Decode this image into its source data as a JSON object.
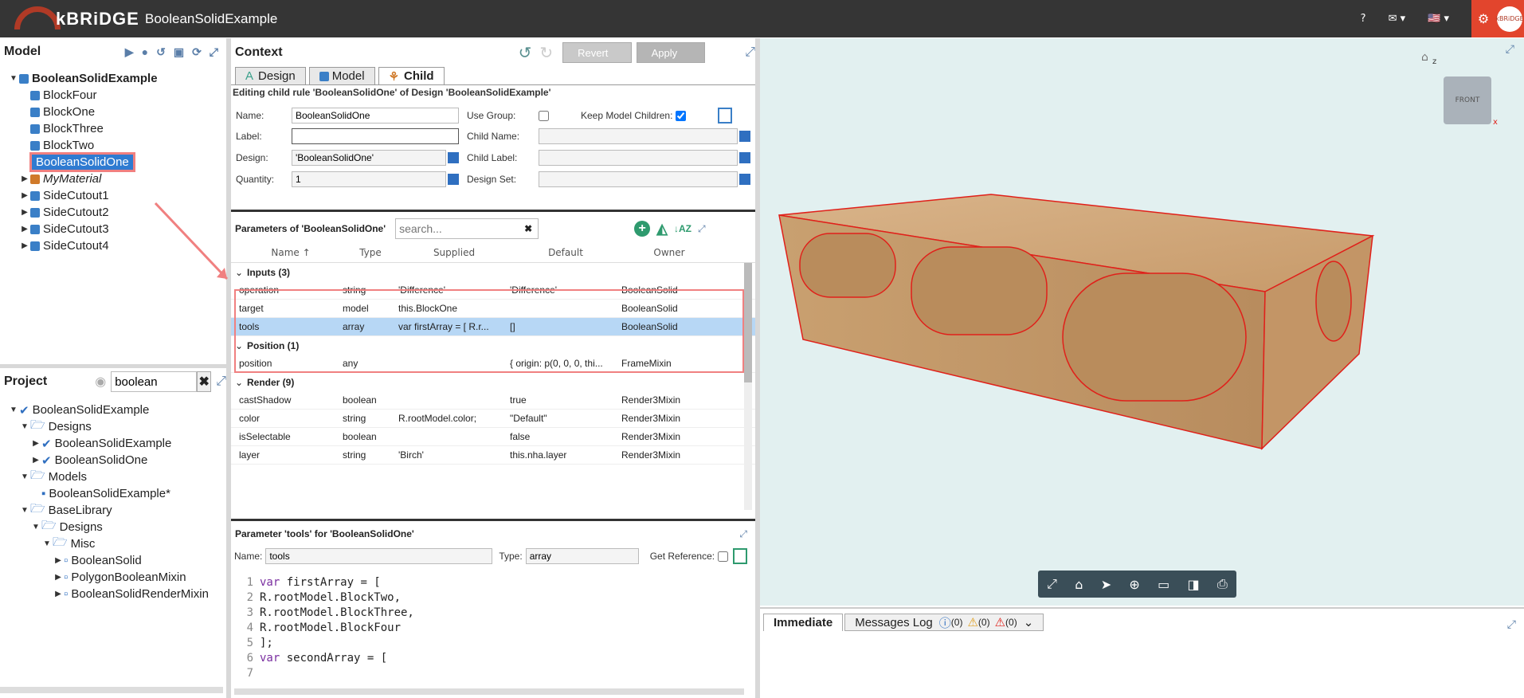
{
  "app": {
    "logo": "kBRiDGE",
    "title": "BooleanSolidExample",
    "help": "?",
    "mail": "✉",
    "flag": "🇺🇸",
    "avatar_text": "kBRiDGE"
  },
  "model": {
    "title": "Model",
    "tree": [
      {
        "label": "BooleanSolidExample",
        "level": 0,
        "expanded": true,
        "bold": true
      },
      {
        "label": "BlockFour",
        "level": 1
      },
      {
        "label": "BlockOne",
        "level": 1
      },
      {
        "label": "BlockThree",
        "level": 1
      },
      {
        "label": "BlockTwo",
        "level": 1
      },
      {
        "label": "BooleanSolidOne",
        "level": 1,
        "selected": true
      },
      {
        "label": "MyMaterial",
        "level": 1,
        "collapsed": true,
        "italic": true
      },
      {
        "label": "SideCutout1",
        "level": 1,
        "collapsed": true
      },
      {
        "label": "SideCutout2",
        "level": 1,
        "collapsed": true
      },
      {
        "label": "SideCutout3",
        "level": 1,
        "collapsed": true
      },
      {
        "label": "SideCutout4",
        "level": 1,
        "collapsed": true
      }
    ]
  },
  "project": {
    "title": "Project",
    "search_value": "boolean",
    "tree": [
      {
        "label": "BooleanSolidExample",
        "level": 0
      },
      {
        "label": "Designs",
        "level": 1
      },
      {
        "label": "BooleanSolidExample",
        "level": 2
      },
      {
        "label": "BooleanSolidOne",
        "level": 2
      },
      {
        "label": "Models",
        "level": 1
      },
      {
        "label": "BooleanSolidExample*",
        "level": 2
      },
      {
        "label": "BaseLibrary",
        "level": 1
      },
      {
        "label": "Designs",
        "level": 2
      },
      {
        "label": "Misc",
        "level": 3
      },
      {
        "label": "BooleanSolid",
        "level": 4
      },
      {
        "label": "PolygonBooleanMixin",
        "level": 4
      },
      {
        "label": "BooleanSolidRenderMixin",
        "level": 4
      }
    ]
  },
  "context": {
    "title": "Context",
    "revert": "Revert",
    "apply": "Apply",
    "tabs": [
      "Design",
      "Model",
      "Child"
    ],
    "editing": "Editing child rule 'BooleanSolidOne' of Design 'BooleanSolidExample'",
    "labels": {
      "name": "Name:",
      "label": "Label:",
      "design": "Design:",
      "quantity": "Quantity:",
      "use_group": "Use Group:",
      "keep_children": "Keep Model Children:",
      "child_name": "Child Name:",
      "child_label": "Child Label:",
      "design_set": "Design Set:"
    },
    "values": {
      "name": "BooleanSolidOne",
      "label": "",
      "design": "'BooleanSolidOne'",
      "quantity": "1"
    }
  },
  "params": {
    "title": "Parameters of 'BooleanSolidOne'",
    "search_placeholder": "search...",
    "columns": [
      "Name ↑",
      "Type",
      "Supplied",
      "Default",
      "Owner"
    ],
    "groups": [
      {
        "label": "Inputs (3)",
        "rows": [
          [
            "operation",
            "string",
            "'Difference'",
            "'Difference'",
            "BooleanSolid"
          ],
          [
            "target",
            "model",
            "this.BlockOne",
            "",
            "BooleanSolid"
          ],
          [
            "tools",
            "array",
            "var firstArray = [ R.r...",
            "[]",
            "BooleanSolid"
          ]
        ]
      },
      {
        "label": "Position (1)",
        "rows": [
          [
            "position",
            "any",
            "",
            "{ origin: p(0, 0, 0, thi...",
            "FrameMixin"
          ]
        ]
      },
      {
        "label": "Render (9)",
        "rows": [
          [
            "castShadow",
            "boolean",
            "",
            "true",
            "Render3Mixin"
          ],
          [
            "color",
            "string",
            "R.rootModel.color;",
            "\"Default\"",
            "Render3Mixin"
          ],
          [
            "isSelectable",
            "boolean",
            "",
            "false",
            "Render3Mixin"
          ],
          [
            "layer",
            "string",
            "'Birch'",
            "this.nha.layer",
            "Render3Mixin"
          ]
        ]
      }
    ]
  },
  "param_detail": {
    "title": "Parameter 'tools' for 'BooleanSolidOne'",
    "name_label": "Name:",
    "name_value": "tools",
    "type_label": "Type:",
    "type_value": "array",
    "ref_label": "Get Reference:",
    "code": [
      {
        "n": "1",
        "kw": "var",
        "text": " firstArray = ["
      },
      {
        "n": "2",
        "kw": "",
        "text": "R.rootModel.BlockTwo,"
      },
      {
        "n": "3",
        "kw": "",
        "text": "R.rootModel.BlockThree,"
      },
      {
        "n": "4",
        "kw": "",
        "text": "R.rootModel.BlockFour"
      },
      {
        "n": "5",
        "kw": "",
        "text": "];"
      },
      {
        "n": "6",
        "kw": "var",
        "text": " secondArray = ["
      },
      {
        "n": "7",
        "kw": "",
        "text": ""
      }
    ]
  },
  "viewer": {
    "cube_face": "FRONT",
    "axis_z": "z",
    "axis_x": "x"
  },
  "bottom": {
    "tab_immediate": "Immediate",
    "tab_messages": "Messages Log",
    "info_count": "(0)",
    "warn_count": "(0)",
    "err_count": "(0)"
  }
}
